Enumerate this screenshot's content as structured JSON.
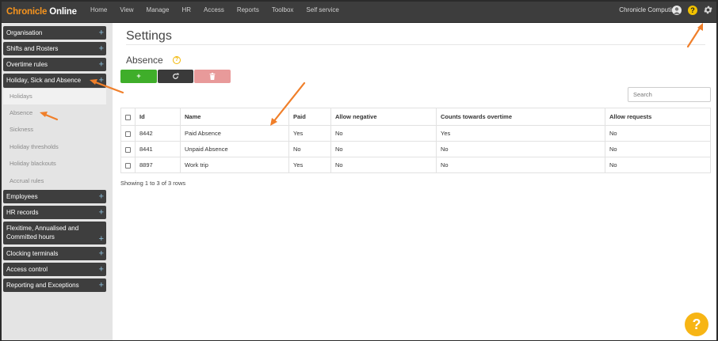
{
  "navbar": {
    "brand_part1": "Chronicle",
    "brand_part2": " Online",
    "items": [
      "Home",
      "View",
      "Manage",
      "HR",
      "Access",
      "Reports",
      "Toolbox",
      "Self service"
    ],
    "company": "Chronicle Computing",
    "help_label": "?",
    "icons": [
      "user-avatar-icon",
      "help-icon",
      "gear-icon"
    ]
  },
  "sidebar": {
    "groups": [
      {
        "label": "Organisation",
        "plus": "+"
      },
      {
        "label": "Shifts and Rosters",
        "plus": "+"
      },
      {
        "label": "Overtime rules",
        "plus": "+"
      },
      {
        "label": "Holiday, Sick and Absence",
        "plus": "+"
      },
      {
        "label": "Employees",
        "plus": "+"
      },
      {
        "label": "HR records",
        "plus": "+"
      },
      {
        "label": "Flexitime, Annualised and Committed hours",
        "plus": "+"
      },
      {
        "label": "Clocking terminals",
        "plus": "+"
      },
      {
        "label": "Access control",
        "plus": "+"
      },
      {
        "label": "Reporting and Exceptions",
        "plus": "+"
      }
    ],
    "sub_items": [
      "Holidays",
      "Absence",
      "Sickness",
      "Holiday thresholds",
      "Holiday blackouts",
      "Accrual rules"
    ],
    "active_sub_item": "Absence"
  },
  "main": {
    "page_title": "Settings",
    "section_title": "Absence",
    "info_label": "?",
    "buttons": {
      "add": "+",
      "refresh": "refresh-icon",
      "delete": "trash-icon"
    },
    "search_placeholder": "Search",
    "table": {
      "headers": [
        "Id",
        "Name",
        "Paid",
        "Allow negative",
        "Counts towards overtime",
        "Allow requests"
      ],
      "rows": [
        [
          "8442",
          "Paid Absence",
          "Yes",
          "No",
          "Yes",
          "No"
        ],
        [
          "8441",
          "Unpaid Absence",
          "No",
          "No",
          "No",
          "No"
        ],
        [
          "8897",
          "Work trip",
          "Yes",
          "No",
          "No",
          "No"
        ]
      ]
    },
    "pagination_text": "Showing 1 to 3 of 3 rows",
    "fab_label": "?"
  },
  "colors": {
    "navbar_bg": "#3d3d3d",
    "brand_accent": "#f7941d",
    "add_button": "#3fae2a",
    "refresh_button": "#3a3a3a",
    "delete_button": "#e89a9a",
    "annotation_arrow": "#f07f2a",
    "help_fab": "#f7b515"
  }
}
